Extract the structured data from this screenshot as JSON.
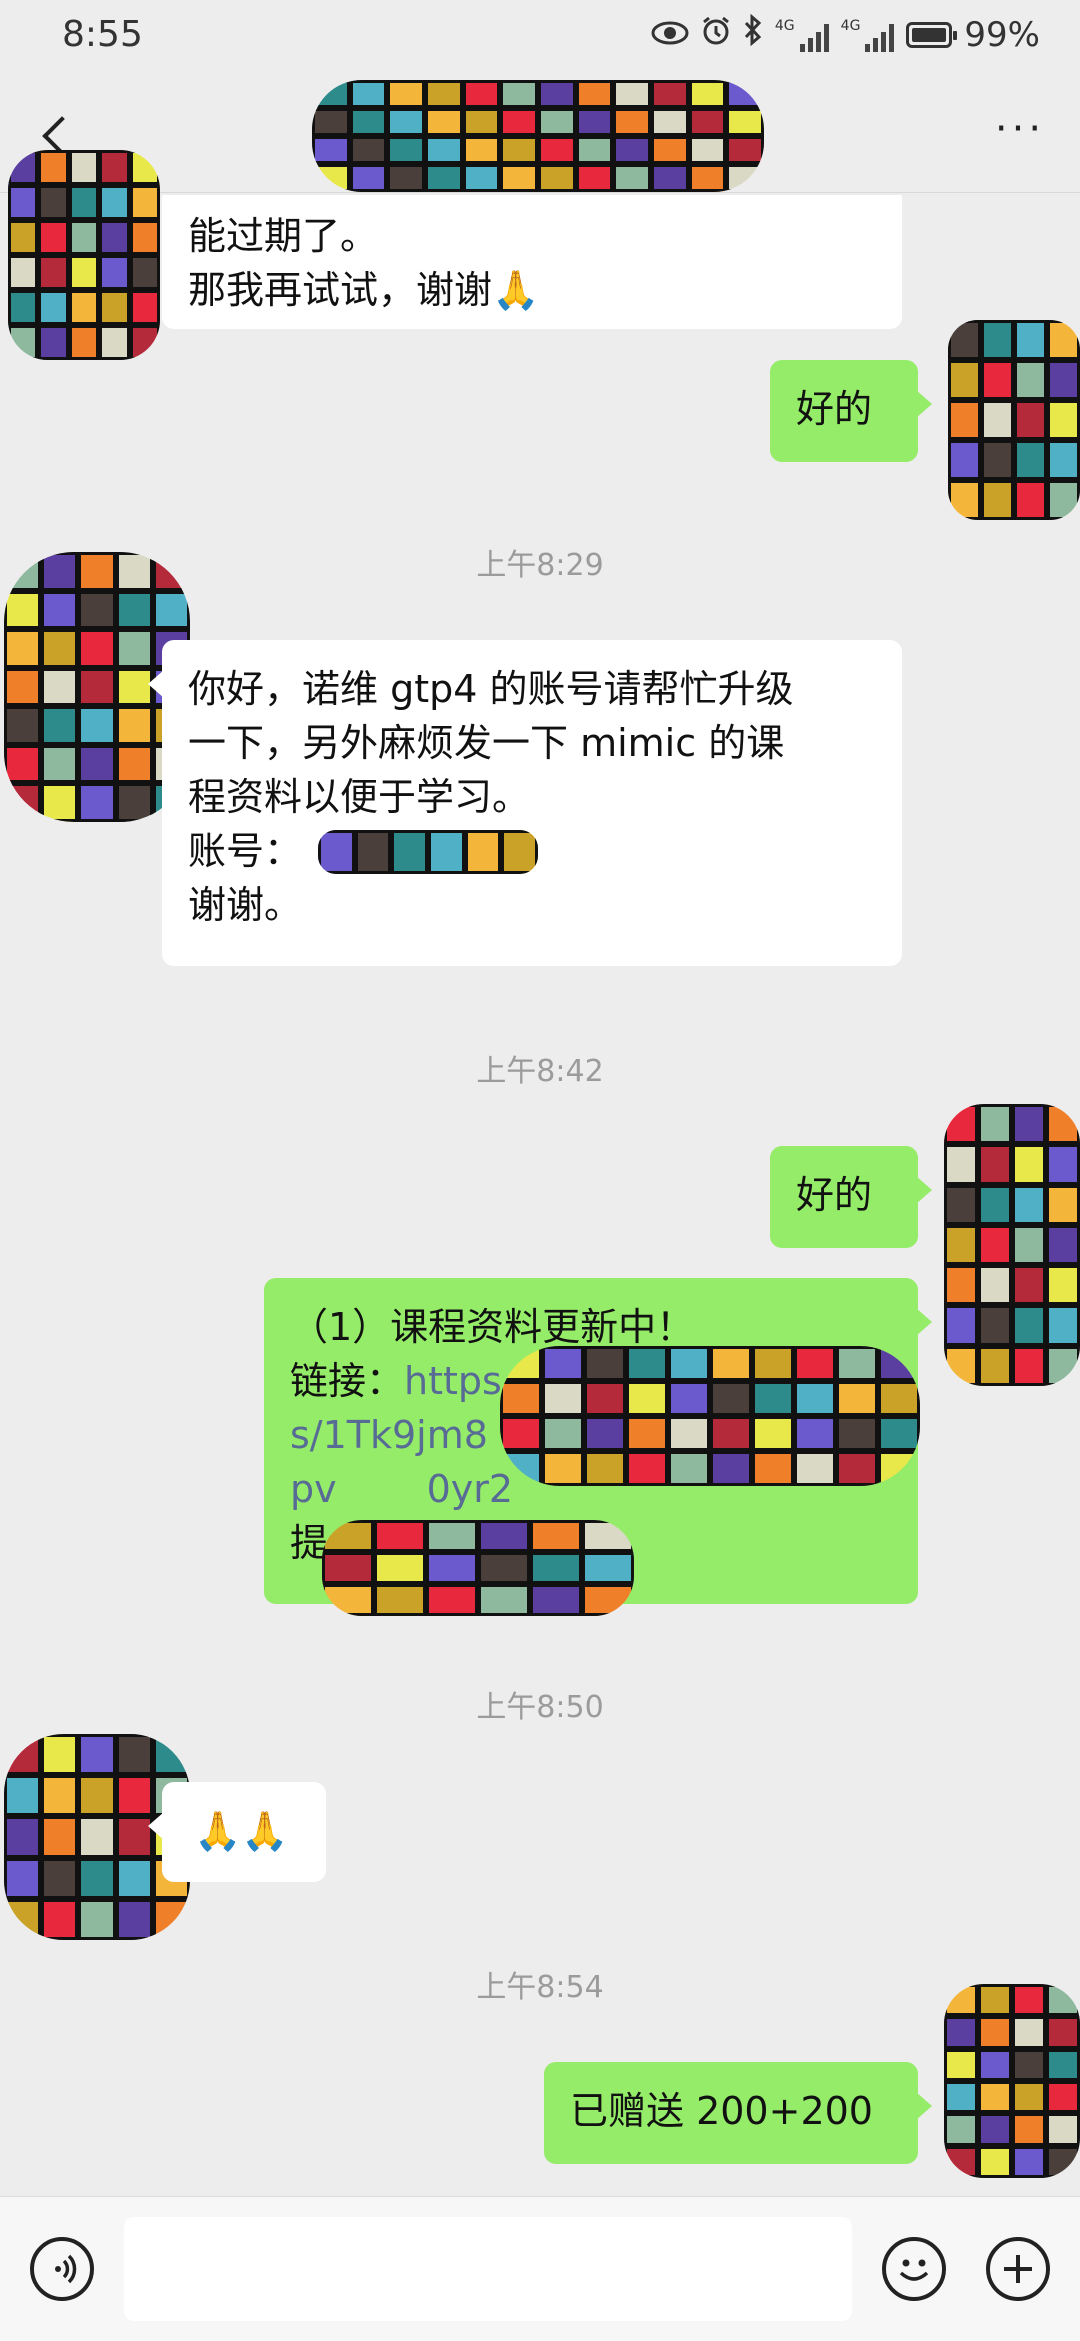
{
  "status_bar": {
    "time": "8:55",
    "network_tag_1": "4G",
    "network_tag_2": "4G",
    "battery": "99%",
    "icons": [
      "eye-icon",
      "alarm-icon",
      "bluetooth-icon",
      "signal-icon",
      "battery-icon"
    ]
  },
  "title_bar": {
    "back_icon": "chevron-left-icon",
    "more_label": "···"
  },
  "messages": {
    "m1": {
      "line1": "能过期了。",
      "line2": "那我再试试，谢谢🙏"
    },
    "m2": {
      "text": "好的"
    },
    "ts1": "上午8:29",
    "m3": {
      "line1": "你好，诺维 gtp4 的账号请帮忙升级",
      "line2": "一下，另外麻烦发一下 mimic 的课",
      "line3": "程资料以便于学习。",
      "line4_label": "账号：",
      "line5": "谢谢。"
    },
    "ts2": "上午8:42",
    "m4": {
      "text": "好的"
    },
    "m5": {
      "line1": "（1）课程资料更新中！",
      "line2_label": "链接：",
      "line2_link": "https",
      "line3": "s/1Tk9jm8",
      "line4": "pv",
      "line4_b": "0yr2",
      "line5": "提"
    },
    "ts3": "上午8:50",
    "m6": {
      "text": "🙏🙏"
    },
    "ts4": "上午8:54",
    "m7": {
      "text": "已赠送 200+200"
    }
  },
  "input_bar": {
    "voice_icon": "voice-icon",
    "emoji_icon": "emoji-icon",
    "plus_icon": "plus-icon"
  },
  "mosaic_palette": [
    "#2e8b8b",
    "#f4b63a",
    "#e8283c",
    "#5b3fa0",
    "#d9d9c6",
    "#e8e84a",
    "#4a3f3a",
    "#4fb0c6",
    "#c9a227",
    "#8fb99e",
    "#f07f2a",
    "#b52a3a",
    "#6a5acd"
  ]
}
